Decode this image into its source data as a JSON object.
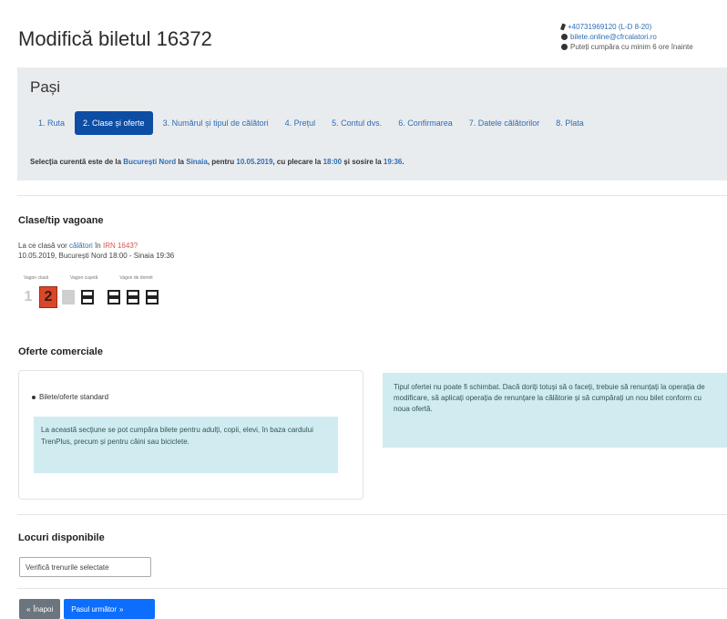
{
  "title": "Modifică biletul 16372",
  "contact": {
    "phone": "+40731969120 (L-D 8-20)",
    "email": "bilete.online@cfrcalatori.ro",
    "note": "Puteți cumpăra cu minim 6 ore înainte"
  },
  "steps": {
    "title": "Pași",
    "items": [
      {
        "label": "1. Ruta"
      },
      {
        "label": "2. Clase și oferte"
      },
      {
        "label": "3. Numărul și tipul de călători"
      },
      {
        "label": "4. Prețul"
      },
      {
        "label": "5. Contul dvs."
      },
      {
        "label": "6. Confirmarea"
      },
      {
        "label": "7. Datele călătorilor"
      },
      {
        "label": "8. Plata"
      }
    ],
    "active_index": 1,
    "selection": {
      "prefix": "Selecția curentă este de la",
      "from": "București Nord",
      "mid": "la",
      "to": "Sinaia",
      "date_prefix": ", pentru",
      "date": "10.05.2019",
      "dep_prefix": ", cu plecare la",
      "dep": "18:00",
      "arr_prefix": "și sosire la",
      "arr": "19:36",
      "end": "."
    }
  },
  "classes": {
    "title": "Clase/tip vagoane",
    "info_line1_a": "La ce clasă vor",
    "info_line1_link": "călători",
    "info_line1_b": "în",
    "info_line1_train": "IRN 1643?",
    "info_line2": "10.05.2019, București Nord 18:00 - Sinaia 19:36",
    "wagon_labels": [
      "Vagon clasă",
      "Vagon cușetă",
      "Vagon de dormit"
    ],
    "wagons": [
      "1",
      "2"
    ]
  },
  "offers": {
    "title": "Oferte comerciale",
    "radio_label": "Bilete/oferte standard",
    "info_text": "La această secțiune se pot cumpăra bilete pentru adulți, copii, elevi, în baza cardului TrenPlus, precum și pentru câini sau biciclete.",
    "warning_text": "Tipul ofertei nu poate fi schimbat. Dacă doriți totuși să o faceți, trebuie să renunțați la operația de modificare, să aplicați operația de renunțare la călătorie și să cumpărați un nou bilet conform cu noua ofertă."
  },
  "seats": {
    "title": "Locuri disponibile",
    "check_button": "Verifică trenurile selectate"
  },
  "nav": {
    "back": "Înapoi",
    "next": "Pasul următor"
  }
}
